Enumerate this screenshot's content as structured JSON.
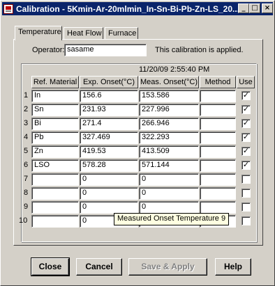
{
  "window": {
    "title": "Calibration - 5Kmin-Ar-20mlmin_In-Sn-Bi-Pb-Zn-LS_20...",
    "minimize": "_",
    "maximize": "□",
    "close": "×"
  },
  "tabs": [
    {
      "label": "Temperature",
      "active": true
    },
    {
      "label": "Heat Flow",
      "active": false
    },
    {
      "label": "Furnace",
      "active": false
    }
  ],
  "operator": {
    "label": "Operator:",
    "value": "sasame"
  },
  "status": "This calibration is applied.",
  "timestamp": "11/20/09 2:55:40 PM",
  "table": {
    "headers": [
      "Ref. Material",
      "Exp. Onset(°C)",
      "Meas. Onset(°C)",
      "Method",
      "Use"
    ],
    "rows": [
      {
        "num": "1",
        "material": "In",
        "exp": "156.6",
        "meas": "153.586",
        "method": "",
        "use": "✓"
      },
      {
        "num": "2",
        "material": "Sn",
        "exp": "231.93",
        "meas": "227.996",
        "method": "",
        "use": "✓"
      },
      {
        "num": "3",
        "material": "Bi",
        "exp": "271.4",
        "meas": "266.946",
        "method": "",
        "use": "✓"
      },
      {
        "num": "4",
        "material": "Pb",
        "exp": "327.469",
        "meas": "322.293",
        "method": "",
        "use": "✓"
      },
      {
        "num": "5",
        "material": "Zn",
        "exp": "419.53",
        "meas": "413.509",
        "method": "",
        "use": "✓"
      },
      {
        "num": "6",
        "material": "LSO",
        "exp": "578.28",
        "meas": "571.144",
        "method": "",
        "use": "✓"
      },
      {
        "num": "7",
        "material": "",
        "exp": "0",
        "meas": "0",
        "method": "",
        "use": ""
      },
      {
        "num": "8",
        "material": "",
        "exp": "0",
        "meas": "0",
        "method": "",
        "use": ""
      },
      {
        "num": "9",
        "material": "",
        "exp": "0",
        "meas": "0",
        "method": "",
        "use": ""
      },
      {
        "num": "10",
        "material": "",
        "exp": "0",
        "meas": "",
        "method": "",
        "use": ""
      }
    ]
  },
  "tooltip": "Measured Onset Temperature 9",
  "buttons": {
    "close": "Close",
    "cancel": "Cancel",
    "save_apply": "Save & Apply",
    "help": "Help"
  }
}
